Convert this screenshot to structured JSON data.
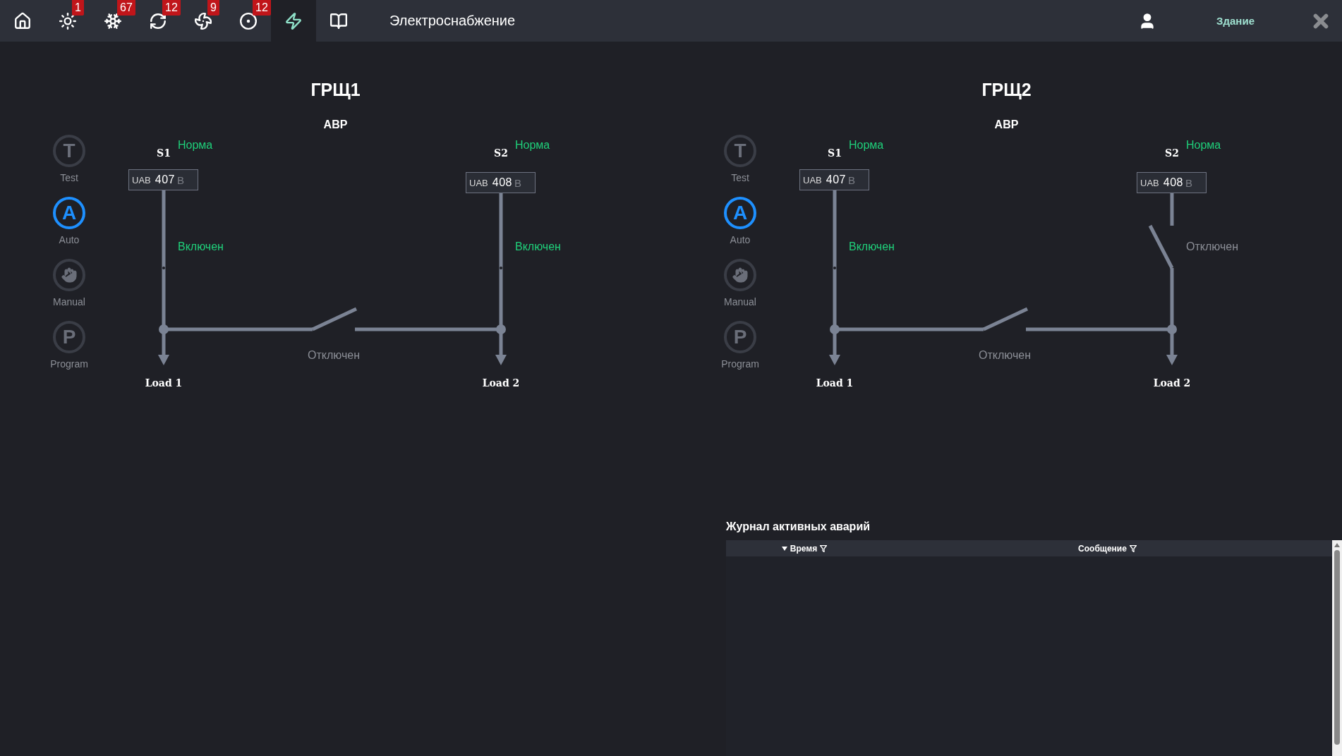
{
  "top_bar": {
    "nav_items": [
      {
        "selected": false
      },
      {
        "badge": "1",
        "selected": false
      },
      {
        "badge": "67",
        "selected": false
      },
      {
        "badge": "12",
        "selected": false
      },
      {
        "badge": "9",
        "selected": false
      },
      {
        "badge": "12",
        "selected": false
      },
      {
        "selected": true
      },
      {
        "selected": false
      }
    ],
    "title": "Электроснабжение",
    "building": "Здание"
  },
  "panels": [
    {
      "title": "ГРЩ1",
      "subtitle": "АВР",
      "modes": [
        {
          "kind": "letter",
          "letter": "T",
          "label": "Test",
          "selected": false
        },
        {
          "kind": "letter",
          "letter": "A",
          "label": "Auto",
          "selected": true
        },
        {
          "kind": "icon",
          "label": "Manual",
          "selected": false
        },
        {
          "kind": "letter",
          "letter": "P",
          "label": "Program",
          "selected": false
        }
      ],
      "sources": [
        {
          "label": "S1",
          "status": "Норма",
          "meter": {
            "name": "UAB",
            "value": "407",
            "unit": "В"
          },
          "breaker": {
            "text": "Включен",
            "on": true
          },
          "load": "Load 1"
        },
        {
          "label": "S2",
          "status": "Норма",
          "meter": {
            "name": "UAB",
            "value": "408",
            "unit": "В"
          },
          "breaker": {
            "text": "Включен",
            "on": true
          },
          "load": "Load 2"
        }
      ],
      "tie": {
        "text": "Отключен",
        "on": false
      }
    },
    {
      "title": "ГРЩ2",
      "subtitle": "АВР",
      "modes": [
        {
          "kind": "letter",
          "letter": "T",
          "label": "Test",
          "selected": false
        },
        {
          "kind": "letter",
          "letter": "A",
          "label": "Auto",
          "selected": true
        },
        {
          "kind": "icon",
          "label": "Manual",
          "selected": false
        },
        {
          "kind": "letter",
          "letter": "P",
          "label": "Program",
          "selected": false
        }
      ],
      "sources": [
        {
          "label": "S1",
          "status": "Норма",
          "meter": {
            "name": "UAB",
            "value": "407",
            "unit": "В"
          },
          "breaker": {
            "text": "Включен",
            "on": true
          },
          "load": "Load 1"
        },
        {
          "label": "S2",
          "status": "Норма",
          "meter": {
            "name": "UAB",
            "value": "408",
            "unit": "В"
          },
          "breaker": {
            "text": "Отключен",
            "on": false
          },
          "load": "Load 2"
        }
      ],
      "tie": {
        "text": "Отключен",
        "on": false
      }
    }
  ],
  "alarm_log": {
    "title": "Журнал активных аварий",
    "columns": [
      {
        "label": "Время",
        "sorted": true
      },
      {
        "label": "Сообщение",
        "sorted": false
      }
    ]
  }
}
